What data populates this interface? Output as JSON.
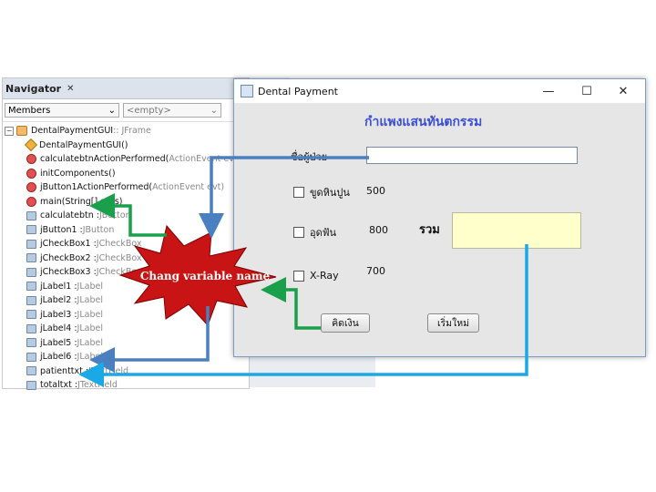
{
  "navigator": {
    "tab_label": "Navigator",
    "close_glyph": "✕",
    "members_select": "Members",
    "filter_select": "<empty>",
    "root": {
      "name": "DentalPaymentGUI",
      "type": " :: JFrame"
    },
    "items": [
      {
        "icon": "ctor",
        "name": "DentalPaymentGUI()",
        "type": ""
      },
      {
        "icon": "method",
        "name": "calculatebtnActionPerformed(",
        "type": "ActionEvent evt)"
      },
      {
        "icon": "method",
        "name": "initComponents()",
        "type": ""
      },
      {
        "icon": "method",
        "name": "jButton1ActionPerformed(",
        "type": "ActionEvent evt)"
      },
      {
        "icon": "method",
        "name": "main(String[] args)",
        "type": ""
      },
      {
        "icon": "field",
        "name": "calculatebtn : ",
        "type": "JButton"
      },
      {
        "icon": "field",
        "name": "jButton1 : ",
        "type": "JButton"
      },
      {
        "icon": "field",
        "name": "jCheckBox1 : ",
        "type": "JCheckBox"
      },
      {
        "icon": "field",
        "name": "jCheckBox2 : ",
        "type": "JCheckBox"
      },
      {
        "icon": "field",
        "name": "jCheckBox3 : ",
        "type": "JCheckBox"
      },
      {
        "icon": "field",
        "name": "jLabel1 : ",
        "type": "JLabel"
      },
      {
        "icon": "field",
        "name": "jLabel2 : ",
        "type": "JLabel"
      },
      {
        "icon": "field",
        "name": "jLabel3 : ",
        "type": "JLabel"
      },
      {
        "icon": "field",
        "name": "jLabel4 : ",
        "type": "JLabel"
      },
      {
        "icon": "field",
        "name": "jLabel5 : ",
        "type": "JLabel"
      },
      {
        "icon": "field",
        "name": "jLabel6 : ",
        "type": "JLabel"
      },
      {
        "icon": "field",
        "name": "patienttxt : ",
        "type": "JTextField"
      },
      {
        "icon": "field",
        "name": "totaltxt : ",
        "type": "JTextField"
      }
    ]
  },
  "window": {
    "title": "Dental Payment",
    "minimize": "—",
    "maximize": "☐",
    "close": "✕"
  },
  "form": {
    "heading": "กำแพงแสนทันตกรรม",
    "patient_label": "ชื่อผู้ป่วย",
    "patient_value": "",
    "options": [
      {
        "label": "ขูดหินปูน",
        "price": "500",
        "checked": false
      },
      {
        "label": "อุดฟัน",
        "price": "800",
        "checked": false
      },
      {
        "label": "X-Ray",
        "price": "700",
        "checked": false
      }
    ],
    "total_label": "รวม",
    "total_value": "",
    "calculate_button": "คิดเงิน",
    "reset_button": "เริ่มใหม่"
  },
  "annotation": {
    "text": "Chang variable name",
    "star_color": "#c81414",
    "green_arrow_color": "#1aa04a",
    "blue_arrow_color": "#4a7fc0",
    "cyan_arrow_color": "#1aa9e6"
  }
}
